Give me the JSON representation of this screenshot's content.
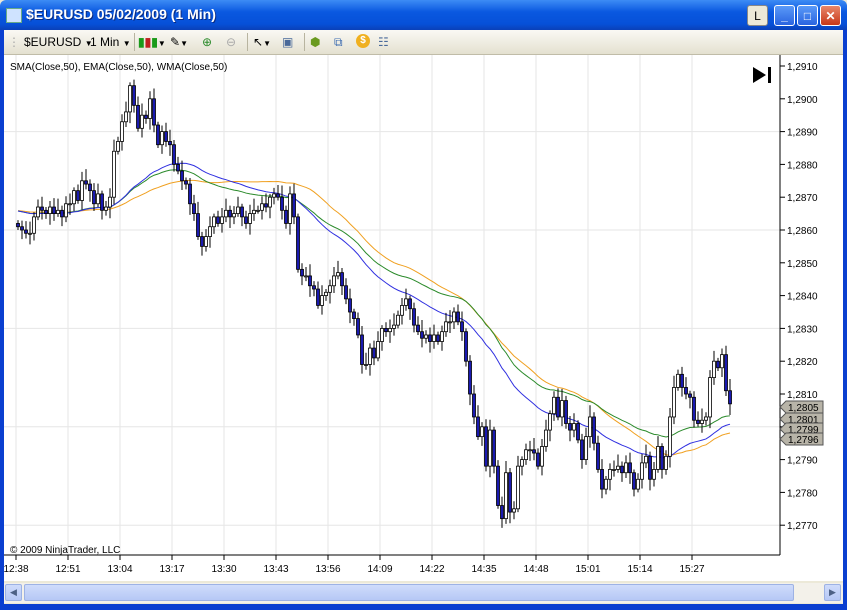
{
  "window": {
    "title": "$EURUSD  05/02/2009 (1 Min)",
    "btn_l": "L"
  },
  "toolbar": {
    "instrument": "$EURUSD",
    "interval": "1 Min"
  },
  "indicators_label": "SMA(Close,50), EMA(Close,50), WMA(Close,50)",
  "copyright": "© 2009 NinjaTrader, LLC",
  "colors": {
    "up_fill": "#ffffff",
    "down_fill": "#1a1ab0",
    "sma": "#f0a020",
    "ema": "#2a8a2a",
    "wma": "#3030e0",
    "grid": "#e6e6e6"
  },
  "chart_data": {
    "type": "candlestick",
    "title": "$EURUSD 05/02/2009 (1 Min)",
    "ylim": [
      1.2765,
      1.2915
    ],
    "yticks": [
      "1,2770",
      "1,2780",
      "1,2790",
      "1,2800",
      "1,2810",
      "1,2820",
      "1,2830",
      "1,2840",
      "1,2850",
      "1,2860",
      "1,2870",
      "1,2880",
      "1,2890",
      "1,2900",
      "1,2910"
    ],
    "xticks": [
      "12:38",
      "12:51",
      "13:04",
      "13:17",
      "13:30",
      "13:43",
      "13:56",
      "14:09",
      "14:22",
      "14:35",
      "14:48",
      "15:01",
      "15:14",
      "15:27"
    ],
    "bar_minutes": 1,
    "first_bar": "12:38",
    "closes": [
      1.2861,
      1.286,
      1.2859,
      1.2859,
      1.2864,
      1.2867,
      1.2866,
      1.2865,
      1.2867,
      1.2865,
      1.2866,
      1.2864,
      1.2868,
      1.2868,
      1.2872,
      1.2869,
      1.2875,
      1.2874,
      1.2872,
      1.2868,
      1.2871,
      1.2866,
      1.2867,
      1.287,
      1.2884,
      1.2887,
      1.2893,
      1.2896,
      1.2904,
      1.2898,
      1.2891,
      1.2895,
      1.2894,
      1.29,
      1.2892,
      1.2886,
      1.289,
      1.2887,
      1.2886,
      1.288,
      1.2878,
      1.2875,
      1.2874,
      1.2868,
      1.2865,
      1.2858,
      1.2855,
      1.2858,
      1.2861,
      1.2864,
      1.2862,
      1.2864,
      1.2866,
      1.2864,
      1.2865,
      1.2867,
      1.2864,
      1.2862,
      1.2865,
      1.2866,
      1.2866,
      1.2868,
      1.2867,
      1.287,
      1.2871,
      1.287,
      1.2866,
      1.2862,
      1.2871,
      1.2864,
      1.2848,
      1.2846,
      1.2846,
      1.2843,
      1.2842,
      1.2837,
      1.284,
      1.2841,
      1.2843,
      1.2846,
      1.2847,
      1.2843,
      1.2839,
      1.2835,
      1.2833,
      1.2828,
      1.2819,
      1.2819,
      1.2824,
      1.2821,
      1.2826,
      1.283,
      1.2829,
      1.283,
      1.2831,
      1.2834,
      1.2837,
      1.2839,
      1.2836,
      1.2831,
      1.2829,
      1.2827,
      1.2828,
      1.2826,
      1.2828,
      1.2826,
      1.2829,
      1.2832,
      1.2832,
      1.2835,
      1.2832,
      1.2829,
      1.282,
      1.281,
      1.2803,
      1.2797,
      1.28,
      1.2788,
      1.2799,
      1.2788,
      1.2776,
      1.2772,
      1.2786,
      1.2774,
      1.2775,
      1.2788,
      1.279,
      1.2793,
      1.2793,
      1.2792,
      1.2788,
      1.2794,
      1.2799,
      1.2804,
      1.2809,
      1.2803,
      1.2808,
      1.2801,
      1.2799,
      1.2801,
      1.2796,
      1.279,
      1.2797,
      1.2803,
      1.2795,
      1.2787,
      1.2781,
      1.2784,
      1.2787,
      1.2787,
      1.2788,
      1.2786,
      1.2789,
      1.2786,
      1.2781,
      1.2784,
      1.2789,
      1.2791,
      1.2784,
      1.2787,
      1.2794,
      1.2787,
      1.2791,
      1.2803,
      1.2812,
      1.2816,
      1.2812,
      1.281,
      1.2809,
      1.2802,
      1.2801,
      1.2802,
      1.2803,
      1.2815,
      1.282,
      1.2818,
      1.2822,
      1.2811,
      1.2807
    ],
    "series": [
      {
        "name": "SMA(Close,50)",
        "period": 50,
        "last": "1,2796"
      },
      {
        "name": "EMA(Close,50)",
        "period": 50,
        "last": "1,2799"
      },
      {
        "name": "WMA(Close,50)",
        "period": 50,
        "last": "1,2801"
      }
    ],
    "last_price": "1,2805",
    "grid": true
  }
}
